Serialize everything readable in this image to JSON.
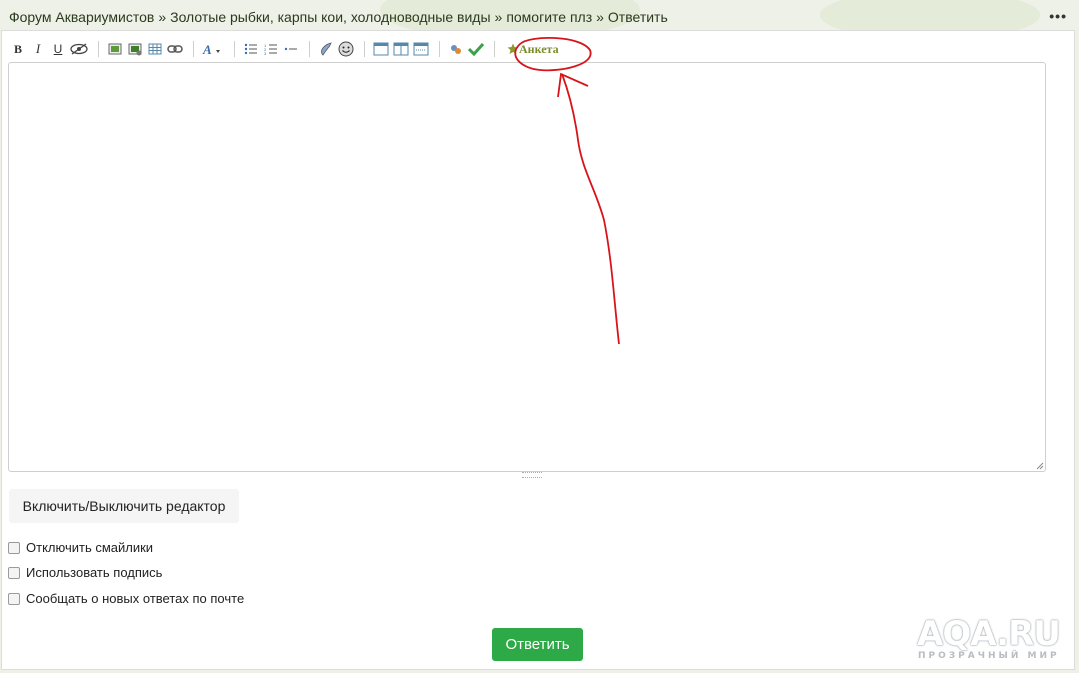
{
  "breadcrumb": {
    "items": [
      "Форум Аквариумистов",
      "Золотые рыбки, карпы кои, холодноводные виды",
      "помогите плз",
      "Ответить"
    ],
    "separator": "»"
  },
  "menu_dots": "•••",
  "toolbar": {
    "bold": "B",
    "italic": "I",
    "underline": "U",
    "anketa_label": "Анкета"
  },
  "toggle_editor_label": "Включить/Выключить редактор",
  "options": [
    {
      "label": "Отключить смайлики",
      "checked": false
    },
    {
      "label": "Использовать подпись",
      "checked": false
    },
    {
      "label": "Сообщать о новых ответах по почте",
      "checked": false
    }
  ],
  "reply_button": "Ответить",
  "watermark": {
    "main": "AQA.RU",
    "sub": "ПРОЗРАЧНЫЙ МИР"
  },
  "colors": {
    "reply_green": "#2daa47",
    "annotation_red": "#d8141b",
    "anketa_olive": "#7a8b2a"
  }
}
